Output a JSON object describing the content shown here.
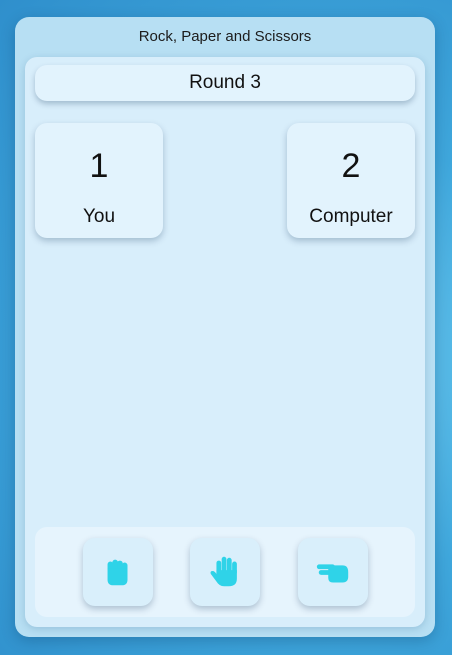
{
  "window": {
    "title": "Rock, Paper and Scissors"
  },
  "round": {
    "label": "Round 3"
  },
  "scores": {
    "you": {
      "value": "1",
      "label": "You"
    },
    "computer": {
      "value": "2",
      "label": "Computer"
    }
  },
  "choices": [
    {
      "name": "rock",
      "icon": "hand-rock-icon"
    },
    {
      "name": "paper",
      "icon": "hand-paper-icon"
    },
    {
      "name": "scissors",
      "icon": "hand-scissors-icon"
    }
  ],
  "colors": {
    "icon": "#2fd3e8",
    "background": "#3fa7dc",
    "panel": "#d8eefb"
  }
}
